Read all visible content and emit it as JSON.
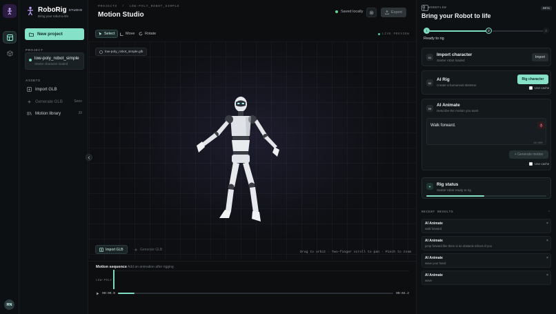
{
  "rail": {
    "avatar": "RN"
  },
  "brand": {
    "name": "RoboRig",
    "studio": "STUDIO",
    "tagline": "Bring your robot to life"
  },
  "sidebar": {
    "new_project": "New project",
    "project_label": "PROJECT",
    "project_name": "low-poly_robot_simple",
    "project_sub": "Starter character loaded",
    "assets_label": "ASSETS",
    "assets": [
      {
        "label": "Import GLB",
        "right": ""
      },
      {
        "label": "Generate GLB",
        "right": "Soon"
      },
      {
        "label": "Motion library",
        "right": "39"
      }
    ]
  },
  "header": {
    "crumb1": "PROJECTS",
    "crumb_sep": "/",
    "crumb2": "LOW-POLY_ROBOT_SIMPLE",
    "title": "Motion Studio",
    "saved": "Saved locally",
    "export": "Export"
  },
  "tools": {
    "select": "Select",
    "move": "Move",
    "rotate": "Rotate",
    "live": "LIVE PREVIEW"
  },
  "viewport": {
    "file_chip": "low-poly_robot_simple.glb",
    "import_btn": "Import GLB",
    "generate_btn": "Generate GLB",
    "hint": "Drag to orbit · Two-finger scroll to pan · Pinch to zoom"
  },
  "timeline": {
    "title": "Motion sequence",
    "subtitle": "Add an animation after rigging",
    "track_label": "LOW-POLY",
    "time_start": "00:00.0",
    "time_end": "00:04.2",
    "progress": 0.06
  },
  "panel": {
    "label": "AI WORKFLOW",
    "title": "Bring your Robot to life",
    "beta": "BETA",
    "steps": [
      "1",
      "2",
      "3"
    ],
    "status": "Ready to rig",
    "import_card": {
      "num": "01",
      "title": "Import character",
      "sub": "Starter robot loaded",
      "btn": "Import"
    },
    "rig_card": {
      "num": "02",
      "title": "AI Rig",
      "sub": "Create a humanoid skeleton",
      "btn": "Rig character",
      "cache": "Use cache"
    },
    "animate_card": {
      "num": "03",
      "title": "AI Animate",
      "sub": "Describe the motion you want",
      "prompt": "Walk forward.",
      "counter": "13/300",
      "btn": "Generate motion",
      "cache": "Use cache"
    },
    "status_card": {
      "title": "Rig status",
      "sub": "Starter robot ready to rig",
      "progress": 0.48
    },
    "recent_label": "RECENT RESULTS",
    "recent": [
      {
        "title": "AI Animate",
        "sub": "walk forward"
      },
      {
        "title": "AI Animate",
        "sub": "jump forward like there is an obstacle infront of you"
      },
      {
        "title": "AI Animate",
        "sub": "wave your hand"
      },
      {
        "title": "AI Animate",
        "sub": "wave"
      }
    ]
  },
  "colors": {
    "accent": "#86e1c9",
    "bg": "#0b0d0f",
    "panel": "#0e1113"
  }
}
